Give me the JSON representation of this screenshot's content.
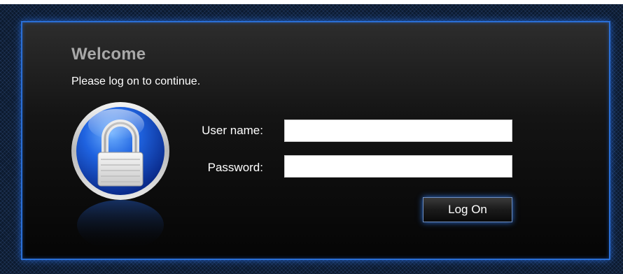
{
  "login": {
    "title": "Welcome",
    "subtitle": "Please log on to continue.",
    "username_label": "User name:",
    "username_value": "",
    "password_label": "Password:",
    "password_value": "",
    "logon_button": "Log On"
  },
  "icons": {
    "lock": "lock-icon"
  },
  "colors": {
    "accent_border": "#2a6fd6",
    "title_gray": "#a8a8a8",
    "icon_blue": "#1a5fd8"
  }
}
